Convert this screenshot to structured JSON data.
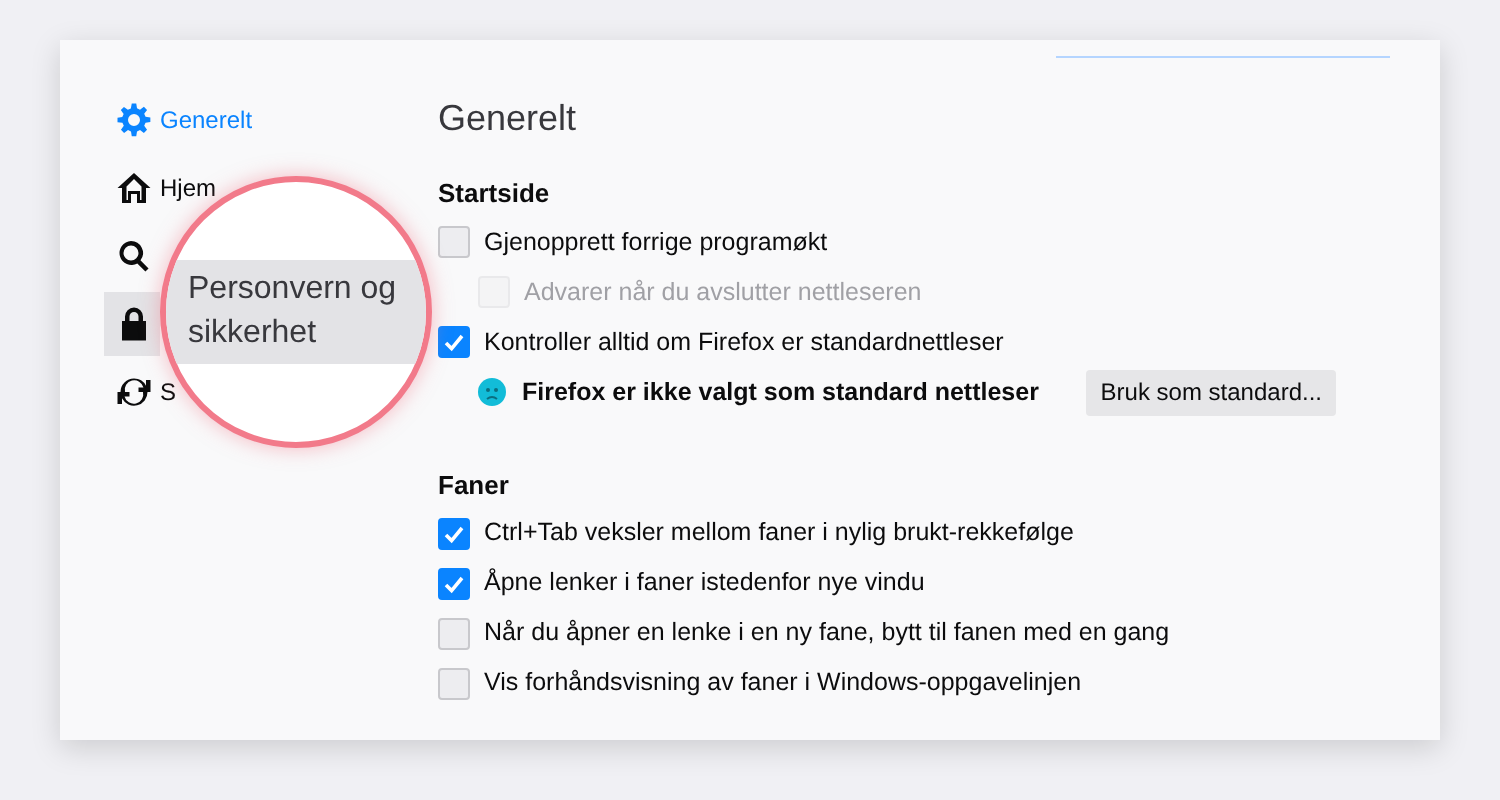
{
  "sidebar": {
    "items": [
      {
        "kind": "gear",
        "label": "Generelt",
        "selected": true
      },
      {
        "kind": "home",
        "label": "Hjem",
        "selected": false
      },
      {
        "kind": "search",
        "selected": false
      },
      {
        "kind": "lock",
        "selected": false
      },
      {
        "kind": "sync",
        "label": "S",
        "selected": false
      }
    ]
  },
  "magnifier": {
    "label": "Personvern og sikkerhet"
  },
  "title": "Generelt",
  "sections": [
    {
      "heading": "Startside",
      "items": [
        {
          "kind": "checkbox",
          "label": "Gjenopprett forrige programøkt",
          "checked": false,
          "disabled": false,
          "children": [
            {
              "kind": "checkbox",
              "label": "Advarer når du avslutter nettleseren",
              "checked": false,
              "disabled": true
            }
          ]
        },
        {
          "kind": "checkbox",
          "label": "Kontroller alltid om Firefox er standardnettleser",
          "checked": true,
          "disabled": false,
          "children": [
            {
              "kind": "status",
              "label": "Firefox er ikke valgt som standard nettleser",
              "button": "Bruk som standard..."
            }
          ]
        }
      ]
    },
    {
      "heading": "Faner",
      "items": [
        {
          "kind": "checkbox",
          "label": "Ctrl+Tab veksler mellom faner i nylig brukt-rekkefølge",
          "checked": true,
          "disabled": false
        },
        {
          "kind": "checkbox",
          "label": "Åpne lenker i faner istedenfor nye vindu",
          "checked": true,
          "disabled": false
        },
        {
          "kind": "checkbox",
          "label": "Når du åpner en lenke i en ny fane, bytt til fanen med en gang",
          "checked": false,
          "disabled": false
        },
        {
          "kind": "checkbox",
          "label": "Vis forhåndsvisning av faner i Windows-oppgavelinjen",
          "checked": false,
          "disabled": false
        }
      ]
    }
  ]
}
